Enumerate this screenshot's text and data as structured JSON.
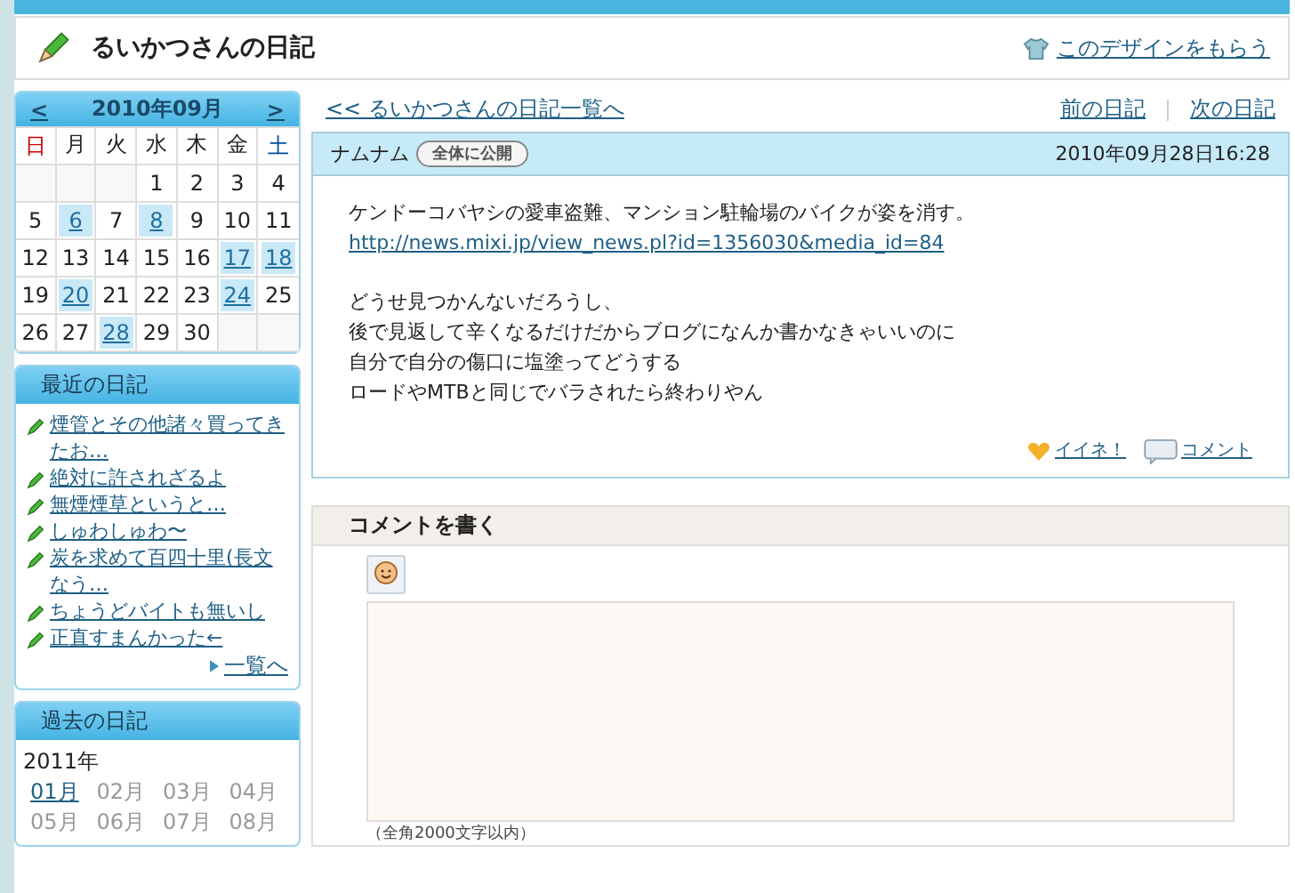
{
  "header": {
    "title": "るいかつさんの日記",
    "design_link": "このデザインをもらう"
  },
  "calendar": {
    "prev": "<",
    "next": ">",
    "month": "2010年09月",
    "weekdays": [
      {
        "label": "日",
        "kind": "sun"
      },
      {
        "label": "月",
        "kind": "day"
      },
      {
        "label": "火",
        "kind": "day"
      },
      {
        "label": "水",
        "kind": "day"
      },
      {
        "label": "木",
        "kind": "day"
      },
      {
        "label": "金",
        "kind": "day"
      },
      {
        "label": "土",
        "kind": "sat"
      }
    ],
    "weeks": [
      [
        {
          "kind": "blank"
        },
        {
          "kind": "blank"
        },
        {
          "kind": "blank"
        },
        {
          "day": "1",
          "linked": false
        },
        {
          "day": "2",
          "linked": false
        },
        {
          "day": "3",
          "linked": false
        },
        {
          "day": "4",
          "linked": false
        }
      ],
      [
        {
          "day": "5",
          "linked": false
        },
        {
          "day": "6",
          "linked": true
        },
        {
          "day": "7",
          "linked": false
        },
        {
          "day": "8",
          "linked": true
        },
        {
          "day": "9",
          "linked": false
        },
        {
          "day": "10",
          "linked": false
        },
        {
          "day": "11",
          "linked": false
        }
      ],
      [
        {
          "day": "12",
          "linked": false
        },
        {
          "day": "13",
          "linked": false
        },
        {
          "day": "14",
          "linked": false
        },
        {
          "day": "15",
          "linked": false
        },
        {
          "day": "16",
          "linked": false
        },
        {
          "day": "17",
          "linked": true
        },
        {
          "day": "18",
          "linked": true
        }
      ],
      [
        {
          "day": "19",
          "linked": false
        },
        {
          "day": "20",
          "linked": true
        },
        {
          "day": "21",
          "linked": false
        },
        {
          "day": "22",
          "linked": false
        },
        {
          "day": "23",
          "linked": false
        },
        {
          "day": "24",
          "linked": true
        },
        {
          "day": "25",
          "linked": false
        }
      ],
      [
        {
          "day": "26",
          "linked": false
        },
        {
          "day": "27",
          "linked": false
        },
        {
          "day": "28",
          "linked": true
        },
        {
          "day": "29",
          "linked": false
        },
        {
          "day": "30",
          "linked": false
        },
        {
          "kind": "blank"
        },
        {
          "kind": "blank"
        }
      ]
    ]
  },
  "recent": {
    "title": "最近の日記",
    "items": [
      "煙管とその他諸々買ってきたお…",
      "絶対に許されざるよ",
      "無煙煙草というと…",
      "しゅわしゅわ〜",
      "炭を求めて百四十里(長文なう…",
      "ちょうどバイトも無いし",
      "正直すまんかった←"
    ],
    "more": "一覧へ"
  },
  "past": {
    "title": "過去の日記",
    "year": "2011年",
    "months": [
      {
        "label": "01月",
        "linked": true
      },
      {
        "label": "02月",
        "linked": false
      },
      {
        "label": "03月",
        "linked": false
      },
      {
        "label": "04月",
        "linked": false
      },
      {
        "label": "05月",
        "linked": false
      },
      {
        "label": "06月",
        "linked": false
      },
      {
        "label": "07月",
        "linked": false
      },
      {
        "label": "08月",
        "linked": false
      }
    ]
  },
  "nav": {
    "back": "<< るいかつさんの日記一覧へ",
    "prev": "前の日記",
    "next": "次の日記"
  },
  "entry": {
    "title": "ナムナム",
    "badge": "全体に公開",
    "date": "2010年09月28日16:28",
    "paragraphs": [
      {
        "lines": [
          "ケンドーコバヤシの愛車盗難、マンション駐輪場のバイクが姿を消す。"
        ],
        "link": "http://news.mixi.jp/view_news.pl?id=1356030&media_id=84"
      },
      {
        "lines": [
          "どうせ見つかんないだろうし、",
          "後で見返して辛くなるだけだからブログになんか書かなきゃいいのに",
          "自分で自分の傷口に塩塗ってどうする",
          "ロードやMTBと同じでバラされたら終わりやん"
        ]
      }
    ],
    "like": "イイネ！",
    "comment": "コメント"
  },
  "comment_form": {
    "title": "コメントを書く",
    "note": "（全角2000文字以内）"
  }
}
